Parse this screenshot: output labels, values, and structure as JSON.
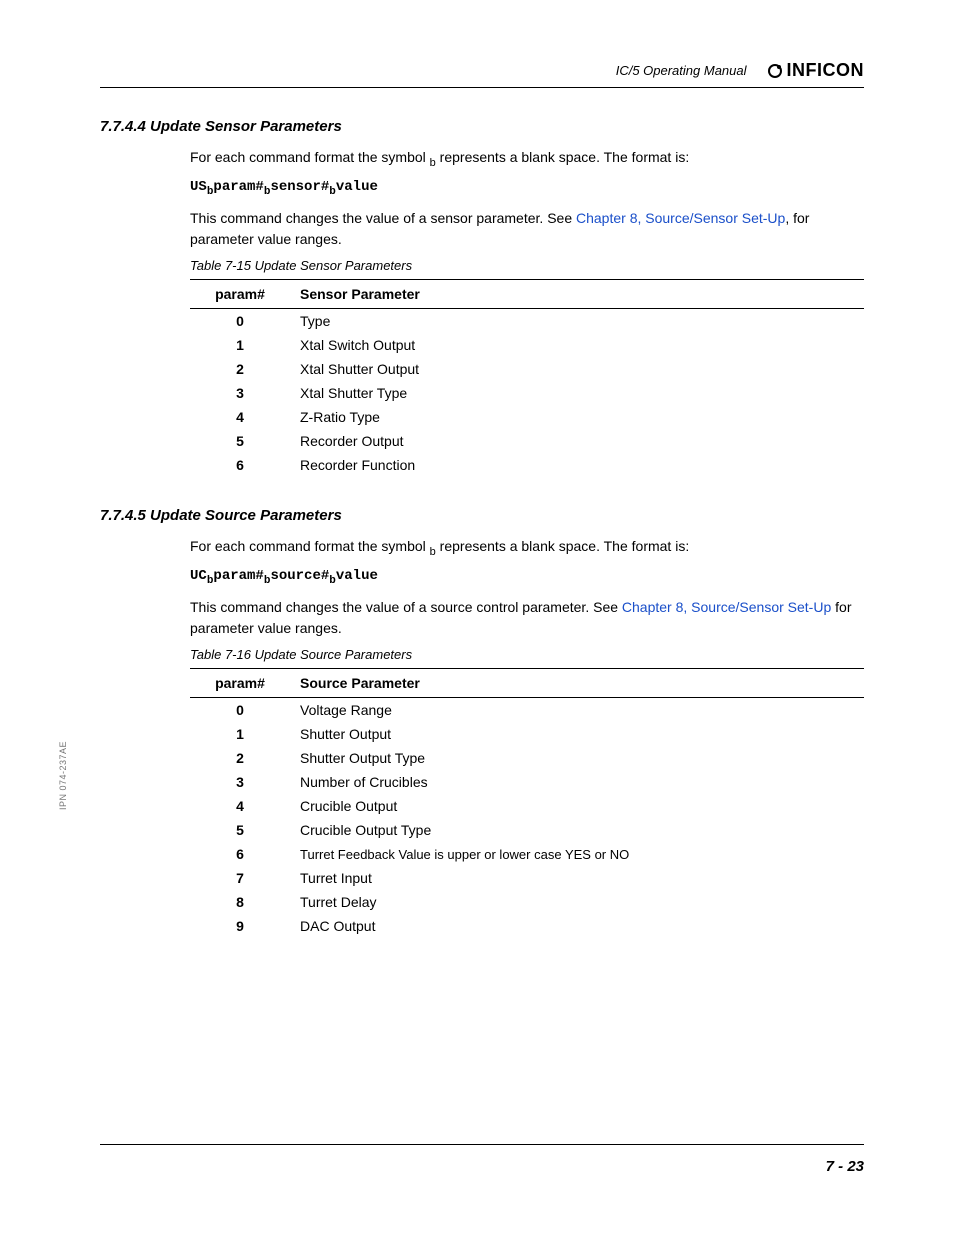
{
  "header": {
    "title": "IC/5 Operating Manual",
    "logo": "INFICON"
  },
  "side_label": "IPN 074-237AE",
  "page_number": "7 - 23",
  "sections": [
    {
      "heading": "7.7.4.4  Update Sensor Parameters",
      "intro1": "For each command format the symbol ",
      "intro_sub": "b",
      "intro2": " represents a blank space. The format is:",
      "cmd": {
        "p1": "US",
        "s1": "b",
        "p2": "param#",
        "s2": "b",
        "p3": "sensor#",
        "s3": "b",
        "p4": "value"
      },
      "desc1": "This command changes the value of a sensor parameter. See ",
      "link1": "Chapter 8, Source/Sensor Set-Up",
      "desc2": ", for parameter value ranges.",
      "table_caption": "Table 7-15  Update Sensor Parameters",
      "table": {
        "headers": [
          "param#",
          "Sensor Parameter"
        ],
        "rows": [
          [
            "0",
            "Type"
          ],
          [
            "1",
            "Xtal Switch Output"
          ],
          [
            "2",
            "Xtal Shutter Output"
          ],
          [
            "3",
            "Xtal Shutter Type"
          ],
          [
            "4",
            "Z-Ratio Type"
          ],
          [
            "5",
            "Recorder Output"
          ],
          [
            "6",
            "Recorder Function"
          ]
        ]
      }
    },
    {
      "heading": "7.7.4.5  Update Source Parameters",
      "intro1": "For each command format the symbol ",
      "intro_sub": "b",
      "intro2": " represents a blank space. The format is:",
      "cmd": {
        "p1": "UC",
        "s1": "b",
        "p2": "param#",
        "s2": "b",
        "p3": "source#",
        "s3": "b",
        "p4": "value"
      },
      "desc1": "This command changes the value of a source control parameter. See ",
      "link1": "Chapter 8, Source/Sensor Set-Up",
      "desc2": " for parameter value ranges.",
      "table_caption": "Table 7-16  Update Source Parameters",
      "table": {
        "headers": [
          "param#",
          "Source Parameter"
        ],
        "rows": [
          [
            "0",
            "Voltage Range"
          ],
          [
            "1",
            "Shutter Output"
          ],
          [
            "2",
            "Shutter Output Type"
          ],
          [
            "3",
            "Number of Crucibles"
          ],
          [
            "4",
            "Crucible Output"
          ],
          [
            "5",
            "Crucible Output Type"
          ],
          [
            "6",
            "Turret Feedback     Value is upper or lower case YES or NO"
          ],
          [
            "7",
            "Turret Input"
          ],
          [
            "8",
            "Turret Delay"
          ],
          [
            "9",
            "DAC Output"
          ]
        ]
      }
    }
  ]
}
